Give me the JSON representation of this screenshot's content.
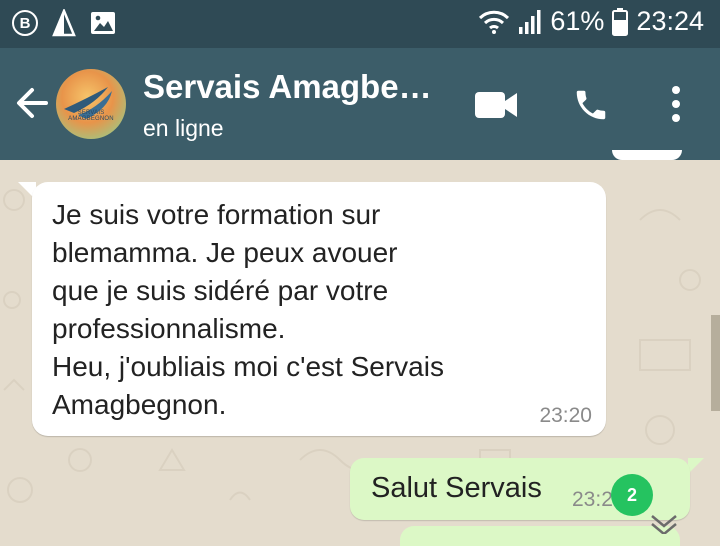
{
  "status_bar": {
    "battery_percent": "61%",
    "time": "23:24",
    "icons": [
      "b-circle-icon",
      "triangle-icon",
      "image-icon",
      "wifi-icon",
      "signal-icon",
      "battery-icon"
    ]
  },
  "chat_header": {
    "contact_name": "Servais Amagbe…",
    "contact_status": "en ligne",
    "avatar_text": "SERVAIS AMAGBEGNON"
  },
  "messages": [
    {
      "direction": "in",
      "lines": [
        "Je suis votre formation sur",
        "blemamma. Je peux avouer",
        "que je suis sidéré par votre",
        "professionnalisme.",
        "Heu, j'oubliais moi c'est Servais",
        "Amagbegnon."
      ],
      "time": "23:20"
    },
    {
      "direction": "out",
      "text": "Salut Servais",
      "time": "23:2"
    }
  ],
  "unread_badge": "2",
  "colors": {
    "status_bar": "#2f4a55",
    "toolbar": "#3c5d69",
    "background": "#e4dccd",
    "bubble_in": "#ffffff",
    "bubble_out": "#dcf8c6",
    "badge": "#25c360"
  }
}
